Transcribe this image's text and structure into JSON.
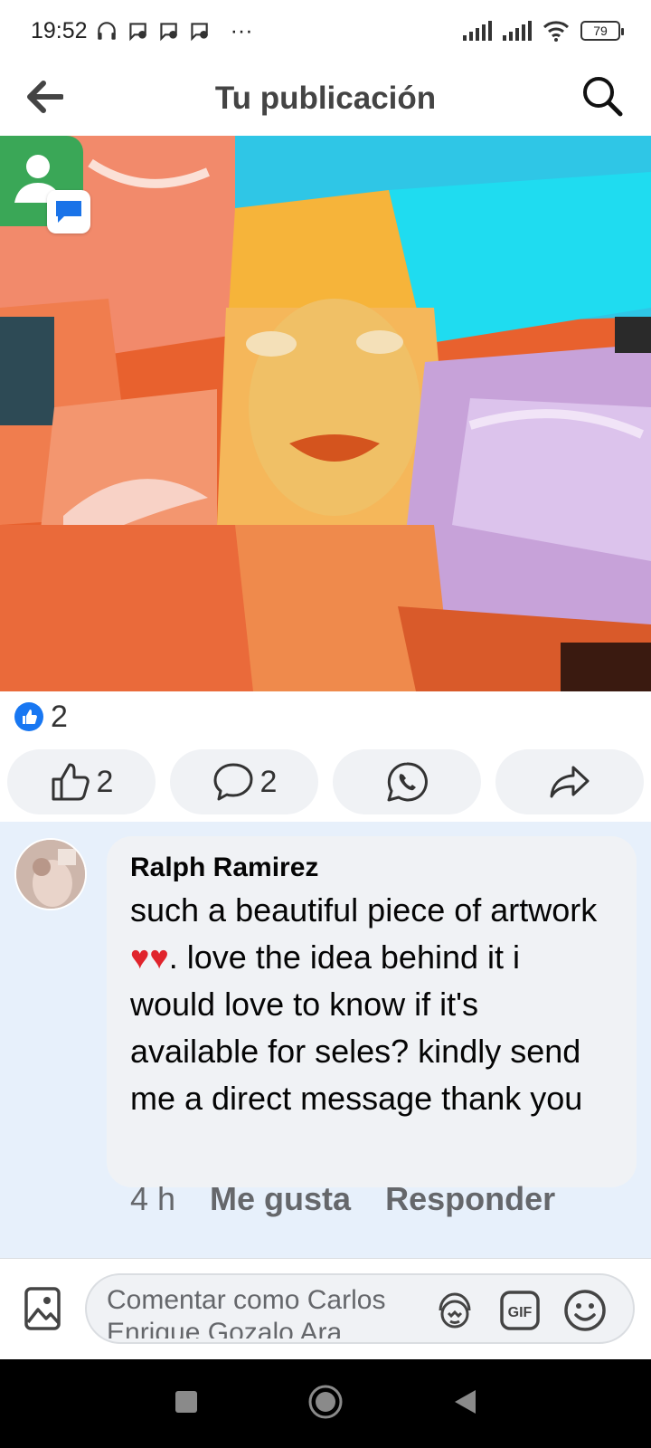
{
  "status_bar": {
    "time": "19:52",
    "more": "···",
    "battery": "79"
  },
  "app_bar": {
    "title": "Tu publicación"
  },
  "post": {
    "reaction_count": "2",
    "actions": {
      "like_count": "2",
      "comment_count": "2"
    }
  },
  "comment": {
    "author": "Ralph Ramirez",
    "text_before_hearts": "such a beautiful piece of artwork ",
    "hearts": "♥♥",
    "text_after_hearts": ". love the idea behind it i would love to know if it's available for seles? kindly send me a direct message thank you",
    "time": "4 h",
    "like_label": "Me gusta",
    "reply_label": "Responder"
  },
  "composer": {
    "placeholder": "Comentar como Carlos Enrique Gozalo Ara"
  },
  "icons": {
    "back": "arrow-left-icon",
    "search": "search-icon",
    "like": "thumbs-up-icon",
    "comment": "comment-bubble-icon",
    "whatsapp": "whatsapp-icon",
    "share": "share-arrow-icon",
    "photo": "photo-icon",
    "avatar_sticker": "avatar-sticker-icon",
    "gif": "gif-icon",
    "emoji": "emoji-icon"
  },
  "colors": {
    "brand_blue": "#1877f2",
    "comment_highlight": "#e7f0fb",
    "heart": "#e0242c",
    "pill_bg": "#f0f2f5"
  }
}
